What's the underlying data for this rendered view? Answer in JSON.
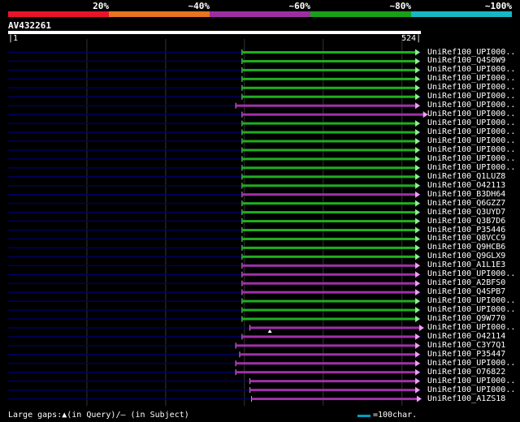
{
  "scale": {
    "labels": [
      "20%",
      "~40%",
      "~60%",
      "~80%",
      "~100%"
    ],
    "colors": [
      "#e8142a",
      "#e8741f",
      "#9c2fa0",
      "#18a018",
      "#17b7c4"
    ]
  },
  "query": {
    "name": "AV432261",
    "start": "1",
    "end": "524"
  },
  "colors": {
    "green": "#1fae1f",
    "purple": "#a030a8",
    "green_arrow": "#90f090",
    "purple_arrow": "#f0a0f0",
    "guide_line": "#000060",
    "grid": "#333333",
    "gap_line": "#c04060"
  },
  "hits": [
    {
      "label": "UniRef100_UPI000..",
      "color": "green",
      "start": 298,
      "end": 524
    },
    {
      "label": "UniRef100_Q4S0W9",
      "color": "green",
      "start": 298,
      "end": 524
    },
    {
      "label": "UniRef100_UPI000..",
      "color": "green",
      "start": 298,
      "end": 524
    },
    {
      "label": "UniRef100_UPI000..",
      "color": "green",
      "start": 298,
      "end": 524
    },
    {
      "label": "UniRef100_UPI000..",
      "color": "green",
      "start": 298,
      "end": 524
    },
    {
      "label": "UniRef100_UPI000..",
      "color": "green",
      "start": 298,
      "end": 524
    },
    {
      "label": "UniRef100_UPI000..",
      "color": "purple",
      "start": 290,
      "end": 524
    },
    {
      "label": "UniRef100_UPI000..",
      "color": "purple",
      "start": 298,
      "end": 534
    },
    {
      "label": "UniRef100_UPI000..",
      "color": "green",
      "start": 298,
      "end": 524
    },
    {
      "label": "UniRef100_UPI000..",
      "color": "green",
      "start": 298,
      "end": 524
    },
    {
      "label": "UniRef100_UPI000..",
      "color": "green",
      "start": 298,
      "end": 524
    },
    {
      "label": "UniRef100_UPI000..",
      "color": "green",
      "start": 298,
      "end": 524
    },
    {
      "label": "UniRef100_UPI000..",
      "color": "green",
      "start": 298,
      "end": 524
    },
    {
      "label": "UniRef100_UPI000..",
      "color": "green",
      "start": 298,
      "end": 524
    },
    {
      "label": "UniRef100_Q1LUZ8",
      "color": "green",
      "start": 298,
      "end": 524
    },
    {
      "label": "UniRef100_O42113",
      "color": "green",
      "start": 298,
      "end": 524
    },
    {
      "label": "UniRef100_B3DH64",
      "color": "purple",
      "start": 298,
      "end": 524
    },
    {
      "label": "UniRef100_Q6GZZ7",
      "color": "green",
      "start": 298,
      "end": 524
    },
    {
      "label": "UniRef100_Q3UYD7",
      "color": "green",
      "start": 298,
      "end": 524
    },
    {
      "label": "UniRef100_Q3B7D6",
      "color": "green",
      "start": 298,
      "end": 524
    },
    {
      "label": "UniRef100_P35446",
      "color": "green",
      "start": 298,
      "end": 524
    },
    {
      "label": "UniRef100_Q8VCC9",
      "color": "green",
      "start": 298,
      "end": 524
    },
    {
      "label": "UniRef100_Q9HCB6",
      "color": "green",
      "start": 298,
      "end": 524
    },
    {
      "label": "UniRef100_Q9GLX9",
      "color": "green",
      "start": 298,
      "end": 524
    },
    {
      "label": "UniRef100_A1L1E3",
      "color": "purple",
      "start": 298,
      "end": 524
    },
    {
      "label": "UniRef100_UPI000..",
      "color": "purple",
      "start": 298,
      "end": 524
    },
    {
      "label": "UniRef100_A2BFS0",
      "color": "purple",
      "start": 298,
      "end": 524
    },
    {
      "label": "UniRef100_Q4SPB7",
      "color": "purple",
      "start": 298,
      "end": 524
    },
    {
      "label": "UniRef100_UPI000..",
      "color": "green",
      "start": 298,
      "end": 524
    },
    {
      "label": "UniRef100_UPI000..",
      "color": "green",
      "start": 298,
      "end": 524
    },
    {
      "label": "UniRef100_Q9W770",
      "color": "green",
      "start": 298,
      "end": 524
    },
    {
      "label": "UniRef100_UPI000..",
      "color": "purple",
      "start": 308,
      "end": 529,
      "gap_marker": true
    },
    {
      "label": "UniRef100_O42114",
      "color": "purple",
      "start": 298,
      "end": 524
    },
    {
      "label": "UniRef100_C3Y7Q1",
      "color": "purple",
      "start": 290,
      "end": 524
    },
    {
      "label": "UniRef100_P35447",
      "color": "purple",
      "start": 295,
      "end": 524
    },
    {
      "label": "UniRef100_UPI000..",
      "color": "purple",
      "start": 290,
      "end": 524
    },
    {
      "label": "UniRef100_O76822",
      "color": "purple",
      "start": 290,
      "end": 524
    },
    {
      "label": "UniRef100_UPI000..",
      "color": "purple",
      "start": 308,
      "end": 524
    },
    {
      "label": "UniRef100_UPI000..",
      "color": "purple",
      "start": 308,
      "end": 524
    },
    {
      "label": "UniRef100_A1ZS18",
      "color": "purple",
      "start": 310,
      "end": 526
    }
  ],
  "footer": {
    "text": "Large gaps:▲(in Query)/— (in Subject)",
    "legend": "=100char."
  }
}
